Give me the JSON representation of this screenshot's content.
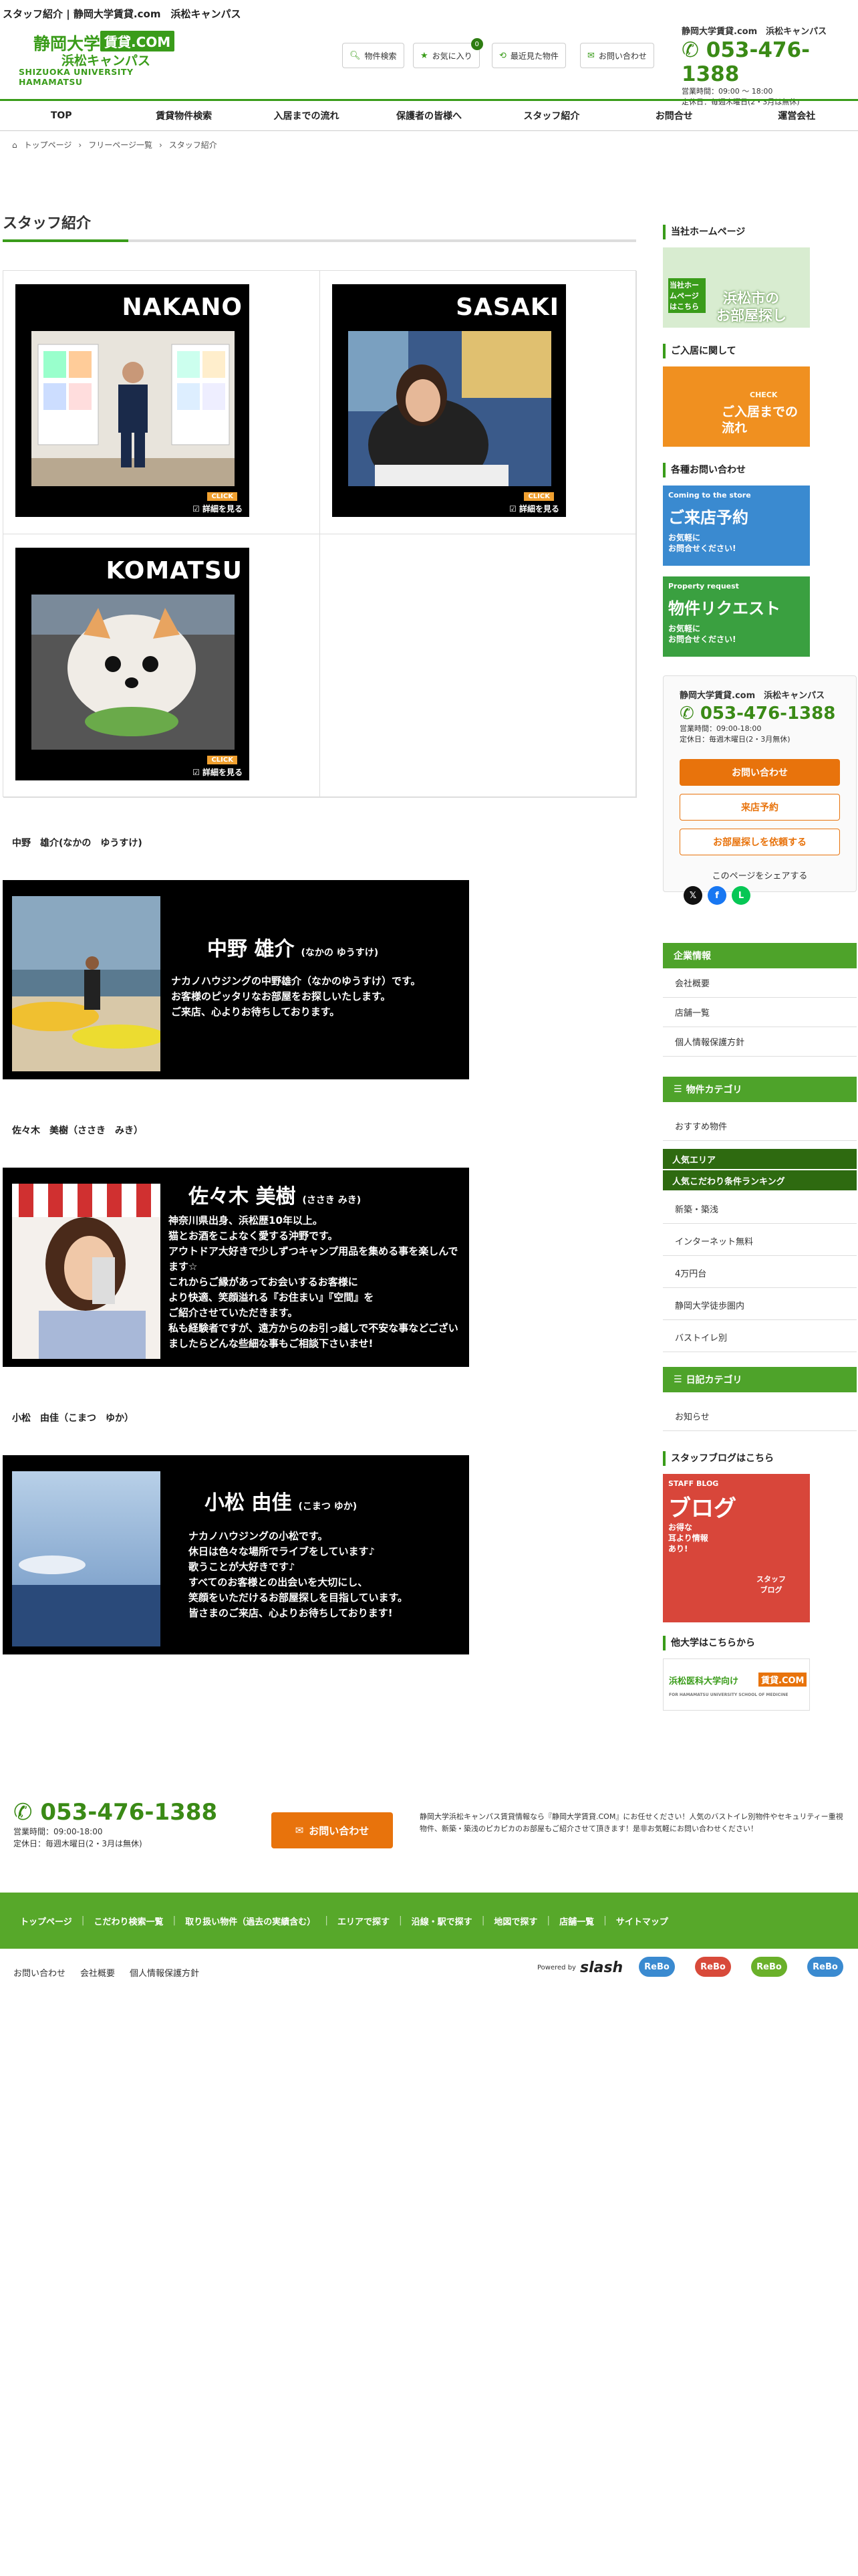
{
  "title": "スタッフ紹介 | 静岡大学賃貸.com　浜松キャンパス",
  "logo": {
    "l1": "静岡大学",
    "badge": "賃貸.COM",
    "l2": "浜松キャンパス",
    "l3": "SHIZUOKA UNIVERSITY HAMAMATSU"
  },
  "header_buttons": [
    {
      "label": "物件検索",
      "icon": "search-icon"
    },
    {
      "label": "お気に入り",
      "icon": "star-icon",
      "badge": "0"
    },
    {
      "label": "最近見た物件",
      "icon": "history-icon"
    },
    {
      "label": "お問い合わせ",
      "icon": "mail-icon"
    }
  ],
  "header_info": {
    "name": "静岡大学賃貸.com　浜松キャンパス",
    "tel": "053-476-1388",
    "hours": "営業時間：09:00 ～ 18:00",
    "closed": "定休日：毎週木曜日(2・3月は無休)"
  },
  "nav": [
    "TOP",
    "賃貸物件検索",
    "入居までの流れ",
    "保護者の皆様へ",
    "スタッフ紹介",
    "お問合せ",
    "運営会社"
  ],
  "breadcrumb": [
    "トップページ",
    "フリーページ一覧",
    "スタッフ紹介"
  ],
  "page_title": "スタッフ紹介",
  "cards": [
    {
      "name": "NAKANO",
      "click": "CLICK",
      "more": "☑ 詳細を見る"
    },
    {
      "name": "SASAKI",
      "click": "CLICK",
      "more": "☑ 詳細を見る"
    },
    {
      "name": "KOMATSU",
      "click": "CLICK",
      "more": "☑ 詳細を見る"
    }
  ],
  "staff": [
    {
      "heading": "中野　雄介(なかの　ゆうすけ)",
      "name": "中野 雄介",
      "kana": "(なかの ゆうすけ)",
      "text": "ナカノハウジングの中野雄介（なかのゆうすけ）です。\nお客様のピッタリなお部屋をお探しいたします。\nご来店、心よりお待ちしております。"
    },
    {
      "heading": "佐々木　美樹（ささき　みき）",
      "name": "佐々木 美樹",
      "kana": "(ささき みき)",
      "text": "神奈川県出身、浜松歴10年以上。\n猫とお酒をこよなく愛する沖野です。\nアウトドア大好きで少しずつキャンプ用品を集める事を楽しんでます☆\nこれからご縁があってお会いするお客様に\nより快適、笑顔溢れる『お住まい』『空間』を\nご紹介させていただきます。\n私も経験者ですが、遠方からのお引っ越しで不安な事などございましたらどんな些細な事もご相談下さいませ!"
    },
    {
      "heading": "小松　由佳（こまつ　ゆか）",
      "name": "小松 由佳",
      "kana": "(こまつ ゆか)",
      "text": "ナカノハウジングの小松です。\n休日は色々な場所でライブをしています♪\n歌うことが大好きです♪\nすべてのお客様との出会いを大切にし、\n笑顔をいただけるお部屋探しを目指しています。\n皆さまのご来店、心よりお待ちしております!"
    }
  ],
  "side": {
    "hp_heading": "当社ホームページ",
    "hp_banner": {
      "t1": "当社ホームページはこちら",
      "t2": "浜松市の",
      "t3": "お部屋探し"
    },
    "move_heading": "ご入居に関して",
    "move_banner": {
      "t1": "CHECK",
      "t2": "ご入居までの流れ"
    },
    "contact_heading": "各種お問い合わせ",
    "visit_banner": {
      "t1": "Coming to the store",
      "t2": "ご来店予約",
      "t3": "お気軽に\nお問合せください!"
    },
    "request_banner": {
      "t1": "Property request",
      "t2": "物件リクエスト",
      "t3": "お気軽に\nお問合せください!"
    },
    "box": {
      "name": "静岡大学賃貸.com　浜松キャンパス",
      "tel": "053-476-1388",
      "hours": "営業時間：09:00-18:00",
      "closed": "定休日：毎週木曜日(2・3月無休)",
      "btn1": "お問い合わせ",
      "btn2": "来店予約",
      "btn3": "お部屋探しを依頼する",
      "share": "このページをシェアする"
    },
    "company_bar": "企業情報",
    "company_links": [
      "会社概要",
      "店舗一覧",
      "個人情報保護方針"
    ],
    "category_bar": "物件カテゴリ",
    "category_links": [
      "おすすめ物件"
    ],
    "area_bar": "人気エリア",
    "ranking_bar": "人気こだわり条件ランキング",
    "ranking_links": [
      "新築・築浅",
      "インターネット無料",
      "4万円台",
      "静岡大学徒歩圏内",
      "バストイレ別"
    ],
    "diary_bar": "日記カテゴリ",
    "diary_links": [
      "お知らせ"
    ],
    "blog_heading": "スタッフブログはこちら",
    "blog_banner": {
      "t1": "STAFF BLOG",
      "t2": "ブログ",
      "t3": "お得な\n耳より情報\nあり!",
      "t4": "スタッフ\nブログ"
    },
    "other_heading": "他大学はこちらから",
    "other_banner": {
      "t1": "浜松医科大学向け",
      "badge": "賃貸.COM",
      "t2": "FOR HAMAMATSU UNIVERSITY SCHOOL OF MEDICINE"
    }
  },
  "footer": {
    "tel": "053-476-1388",
    "hours": "営業時間：09:00-18:00",
    "closed": "定休日：毎週木曜日(2・3月は無休)",
    "btn": "お問い合わせ",
    "desc": "静岡大学浜松キャンパス賃貸情報なら『静岡大学賃貸.COM』にお任せください！人気のバストイレ別物件やセキュリティー重視物件、新築・築浅のピカピカのお部屋もご紹介させて頂きます！是非お気軽にお問い合わせください！",
    "nav": [
      "トップページ",
      "こだわり検索一覧",
      "取り扱い物件（過去の実績含む）",
      "エリアで探す",
      "沿線・駅で探す",
      "地図で探す",
      "店舗一覧",
      "サイトマップ"
    ],
    "bottom": [
      "お問い合わせ",
      "会社概要",
      "個人情報保護方針"
    ],
    "powered": "Powered by",
    "slash": "slash",
    "rebo": [
      "ReBo",
      "ReBo",
      "ReBo",
      "ReBo"
    ]
  },
  "colors": {
    "brand": "#3a9c1a",
    "orange": "#e8730c"
  }
}
